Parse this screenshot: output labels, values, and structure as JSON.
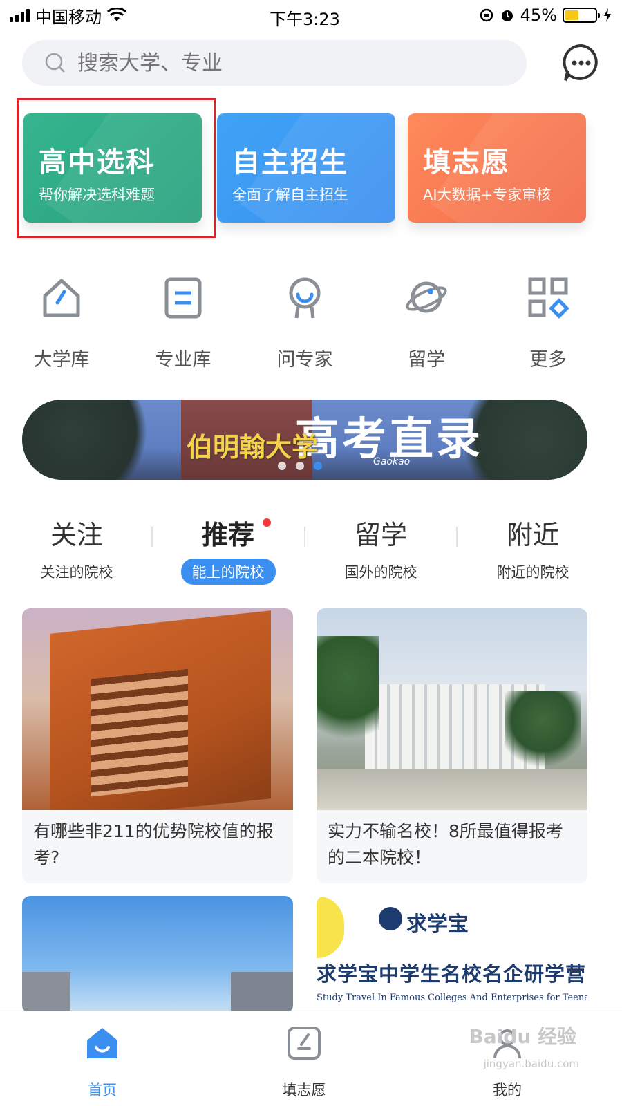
{
  "status_bar": {
    "carrier": "中国移动",
    "time": "下午3:23",
    "battery": "45%",
    "battery_level": 0.45
  },
  "search": {
    "placeholder": "搜索大学、专业"
  },
  "feature_cards": [
    {
      "title": "高中选科",
      "subtitle": "帮你解决选科难题",
      "color": "#2fab87",
      "highlighted": true
    },
    {
      "title": "自主招生",
      "subtitle": "全面了解自主招生",
      "color": "#3d98f3"
    },
    {
      "title": "填志愿",
      "subtitle": "AI大数据+专家审核",
      "color": "#f57a52"
    }
  ],
  "quick_nav": [
    {
      "label": "大学库",
      "icon": "house-icon"
    },
    {
      "label": "专业库",
      "icon": "document-icon"
    },
    {
      "label": "问专家",
      "icon": "expert-icon"
    },
    {
      "label": "留学",
      "icon": "planet-icon"
    },
    {
      "label": "更多",
      "icon": "grid-icon"
    }
  ],
  "banner": {
    "university": "伯明翰大学",
    "slogan": "高考直录",
    "slogan_en": "Gaokao",
    "active_slide": 2,
    "slide_count": 3
  },
  "tabs": [
    {
      "title": "关注",
      "subtitle": "关注的院校"
    },
    {
      "title": "推荐",
      "subtitle": "能上的院校",
      "active": true,
      "has_dot": true
    },
    {
      "title": "留学",
      "subtitle": "国外的院校"
    },
    {
      "title": "附近",
      "subtitle": "附近的院校"
    }
  ],
  "articles": [
    {
      "title": "有哪些非211的优势院校值的报考?"
    },
    {
      "title": " 实力不输名校！8所最值得报考的二本院校！"
    },
    {
      "title": ""
    },
    {
      "title": "",
      "logo_text": "求学宝",
      "strip_text": "求学宝中学生名校名企研学营",
      "strip_en": "Study Travel In Famous Colleges And Enterprises for Teenagres"
    }
  ],
  "bottom_nav": [
    {
      "label": "首页",
      "icon": "home-icon",
      "active": true
    },
    {
      "label": "填志愿",
      "icon": "edit-icon"
    },
    {
      "label": "我的",
      "icon": "profile-icon"
    }
  ],
  "watermark": {
    "text": "Baidu 经验",
    "sub": "jingyan.baidu.com"
  },
  "colors": {
    "accent": "#3b8ff0",
    "highlight_border": "#d9262b",
    "notification_dot": "#f5383a"
  }
}
